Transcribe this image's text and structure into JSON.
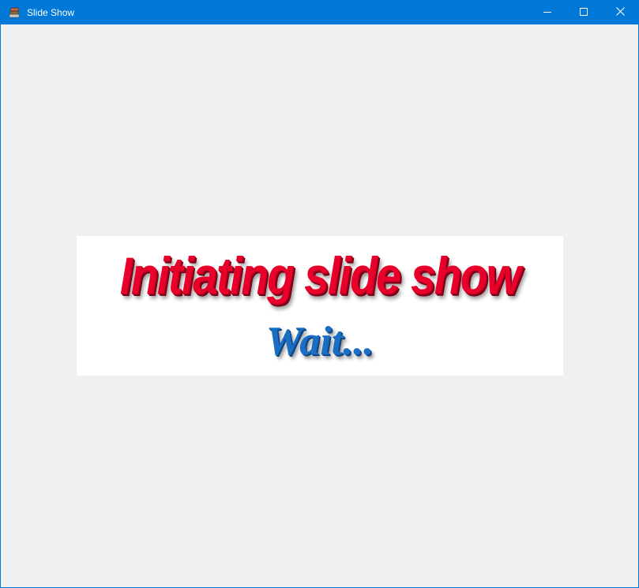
{
  "window": {
    "title": "Slide Show",
    "app_icon": "books-icon",
    "controls": {
      "minimize": "minimize-icon",
      "maximize": "maximize-icon",
      "close": "close-icon"
    },
    "accent_color": "#0078d7"
  },
  "banner": {
    "title": "Initiating slide show",
    "subtitle": "Wait...",
    "title_color": "#e8002a",
    "subtitle_color": "#1a6fc4"
  }
}
